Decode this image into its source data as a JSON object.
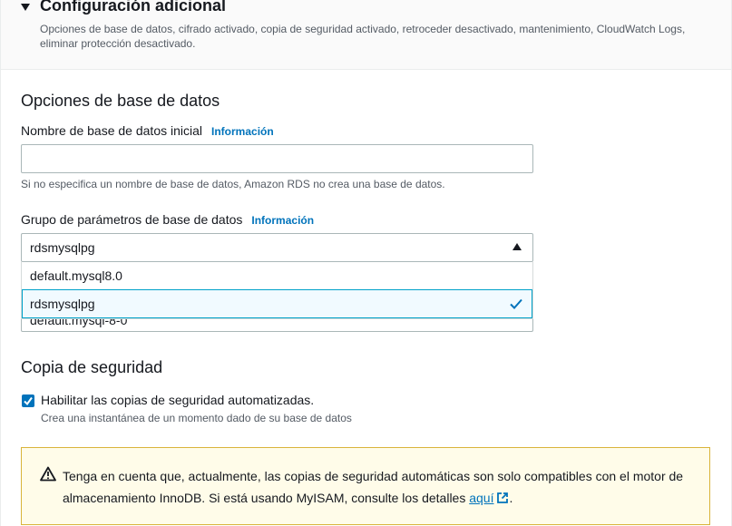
{
  "header": {
    "title": "Configuración adicional",
    "description": "Opciones de base de datos, cifrado activado, copia de seguridad activado, retroceder desactivado, mantenimiento, CloudWatch Logs, eliminar protección desactivado."
  },
  "database_options": {
    "heading": "Opciones de base de datos",
    "initial_db_name": {
      "label": "Nombre de base de datos inicial",
      "info": "Información",
      "value": "",
      "hint": "Si no especifica un nombre de base de datos, Amazon RDS no crea una base de datos."
    },
    "parameter_group": {
      "label": "Grupo de parámetros de base de datos",
      "info": "Información",
      "selected": "rdsmysqlpg",
      "options": [
        "default.mysql8.0",
        "rdsmysqlpg"
      ]
    },
    "hidden_select_value": "default.mysql-8-0"
  },
  "backup": {
    "heading": "Copia de seguridad",
    "automated_checkbox": {
      "label": "Habilitar las copias de seguridad automatizadas.",
      "description": "Crea una instantánea de un momento dado de su base de datos",
      "checked": true
    },
    "alert": {
      "text_part1": "Tenga en cuenta que, actualmente, las copias de seguridad automáticas son solo compatibles con el motor de almacenamiento InnoDB. Si está usando MyISAM, consulte los detalles ",
      "link": "aquí",
      "text_part2": "."
    }
  },
  "colors": {
    "link": "#0073bb",
    "checkbox": "#0073bb",
    "selected_option_border": "#00a1c9",
    "alert_border": "#d9b43a",
    "alert_background": "#fffce9"
  }
}
